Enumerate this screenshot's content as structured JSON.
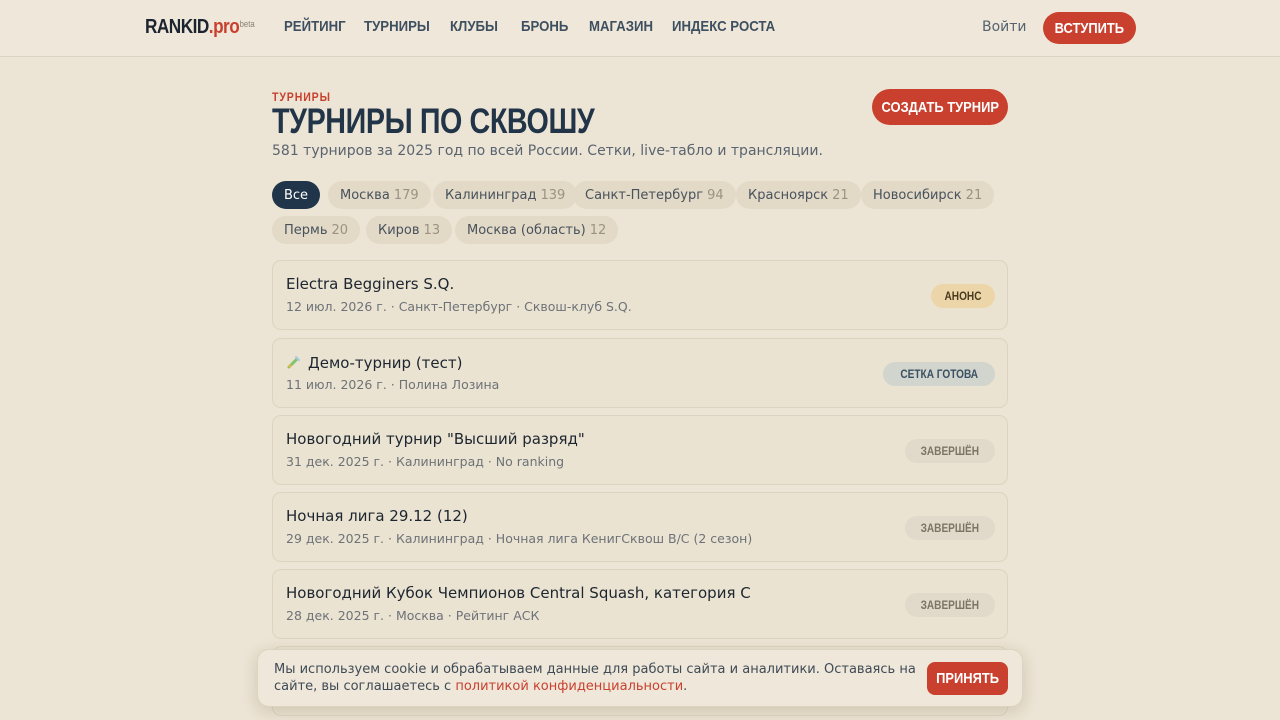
{
  "brand": {
    "name": "RANKID",
    "suffix": ".pro",
    "badge": "beta"
  },
  "nav": [
    "РЕЙТИНГ",
    "ТУРНИРЫ",
    "КЛУБЫ",
    "БРОНЬ",
    "МАГАЗИН",
    "ИНДЕКС РОСТА"
  ],
  "header": {
    "login": "Войти",
    "join": "ВСТУПИТЬ"
  },
  "page": {
    "eyebrow": "ТУРНИРЫ",
    "title": "ТУРНИРЫ ПО СКВОШУ",
    "subtitle": "581 турниров за 2025 год по всей России. Сетки, live-табло и трансляции.",
    "create_button": "СОЗДАТЬ ТУРНИР"
  },
  "filters": [
    {
      "label": "Все",
      "count": "",
      "active": true
    },
    {
      "label": "Москва",
      "count": "179"
    },
    {
      "label": "Калининград",
      "count": "139"
    },
    {
      "label": "Санкт-Петербург",
      "count": "94"
    },
    {
      "label": "Красноярск",
      "count": "21"
    },
    {
      "label": "Новосибирск",
      "count": "21"
    },
    {
      "label": "Пермь",
      "count": "20"
    },
    {
      "label": "Киров",
      "count": "13"
    },
    {
      "label": "Москва (область)",
      "count": "12"
    }
  ],
  "tournaments": [
    {
      "title": "Electra Begginers S.Q.",
      "meta": "12 июл. 2026 г. · Санкт-Петербург · Сквош-клуб S.Q.",
      "status": "АНОНС",
      "status_kind": "announce"
    },
    {
      "title": "Демо-турнир (тест)",
      "meta": "11 июл. 2026 г. · Полина Лозина",
      "status": "СЕТКА ГОТОВА",
      "status_kind": "ready",
      "icon": "test-tube-icon"
    },
    {
      "title": "Новогодний турнир \"Высший разряд\"",
      "meta": "31 дек. 2025 г. · Калининград · No ranking",
      "status": "ЗАВЕРШЁН",
      "status_kind": "done"
    },
    {
      "title": "Ночная лига 29.12 (12)",
      "meta": "29 дек. 2025 г. · Калининград · Ночная лига КенигСквош В/С (2 сезон)",
      "status": "ЗАВЕРШЁН",
      "status_kind": "done"
    },
    {
      "title": "Новогодний Кубок Чемпионов Central Squash, категория С",
      "meta": "28 дек. 2025 г. · Москва · Рейтинг АСК",
      "status": "ЗАВЕРШЁН",
      "status_kind": "done"
    }
  ],
  "cookie": {
    "text": "Мы используем cookie и обрабатываем данные для работы сайта и аналитики. Оставаясь на сайте, вы соглашаетесь с ",
    "link": "политикой конфиденциальности",
    "tail": ".",
    "accept": "ПРИНЯТЬ"
  },
  "colors": {
    "accent": "#c9402e",
    "navy": "#203549",
    "background": "#ece4d4"
  }
}
